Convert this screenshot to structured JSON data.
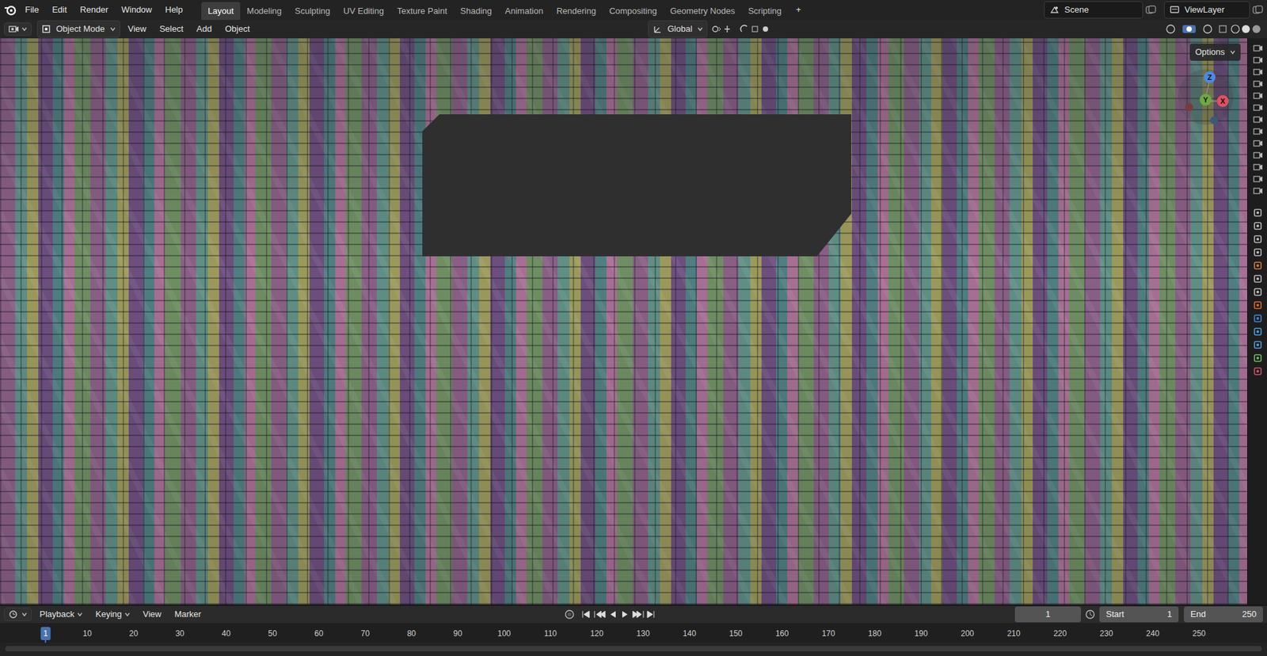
{
  "menus": [
    "File",
    "Edit",
    "Render",
    "Window",
    "Help"
  ],
  "workspaces": [
    {
      "label": "Layout",
      "selected": true
    },
    {
      "label": "Modeling",
      "selected": false
    },
    {
      "label": "Sculpting",
      "selected": false
    },
    {
      "label": "UV Editing",
      "selected": false
    },
    {
      "label": "Texture Paint",
      "selected": false
    },
    {
      "label": "Shading",
      "selected": false
    },
    {
      "label": "Animation",
      "selected": false
    },
    {
      "label": "Rendering",
      "selected": false
    },
    {
      "label": "Compositing",
      "selected": false
    },
    {
      "label": "Geometry Nodes",
      "selected": false
    },
    {
      "label": "Scripting",
      "selected": false
    }
  ],
  "add_workspace": "+",
  "scene": "Scene",
  "view_layer": "ViewLayer",
  "viewport_header": {
    "mode": "Object Mode",
    "menus": [
      "View",
      "Select",
      "Add",
      "Object"
    ],
    "orientation": "Global",
    "options": "Options"
  },
  "gizmo": {
    "axes": [
      "X",
      "Y",
      "Z"
    ]
  },
  "timeline": {
    "menus": [
      "Playback",
      "Keying",
      "View",
      "Marker"
    ],
    "current_frame": "1",
    "start_label": "Start",
    "start": "1",
    "end_label": "End",
    "end": "250",
    "ticks": [
      {
        "label": "1",
        "selected": true
      },
      {
        "label": "10",
        "selected": false
      },
      {
        "label": "20",
        "selected": false
      },
      {
        "label": "30",
        "selected": false
      },
      {
        "label": "40",
        "selected": false
      },
      {
        "label": "50",
        "selected": false
      },
      {
        "label": "60",
        "selected": false
      },
      {
        "label": "70",
        "selected": false
      },
      {
        "label": "80",
        "selected": false
      },
      {
        "label": "90",
        "selected": false
      },
      {
        "label": "100",
        "selected": false
      },
      {
        "label": "110",
        "selected": false
      },
      {
        "label": "120",
        "selected": false
      },
      {
        "label": "130",
        "selected": false
      },
      {
        "label": "140",
        "selected": false
      },
      {
        "label": "150",
        "selected": false
      },
      {
        "label": "160",
        "selected": false
      },
      {
        "label": "170",
        "selected": false
      },
      {
        "label": "180",
        "selected": false
      },
      {
        "label": "190",
        "selected": false
      },
      {
        "label": "200",
        "selected": false
      },
      {
        "label": "210",
        "selected": false
      },
      {
        "label": "220",
        "selected": false
      },
      {
        "label": "230",
        "selected": false
      },
      {
        "label": "240",
        "selected": false
      },
      {
        "label": "250",
        "selected": false
      }
    ]
  }
}
